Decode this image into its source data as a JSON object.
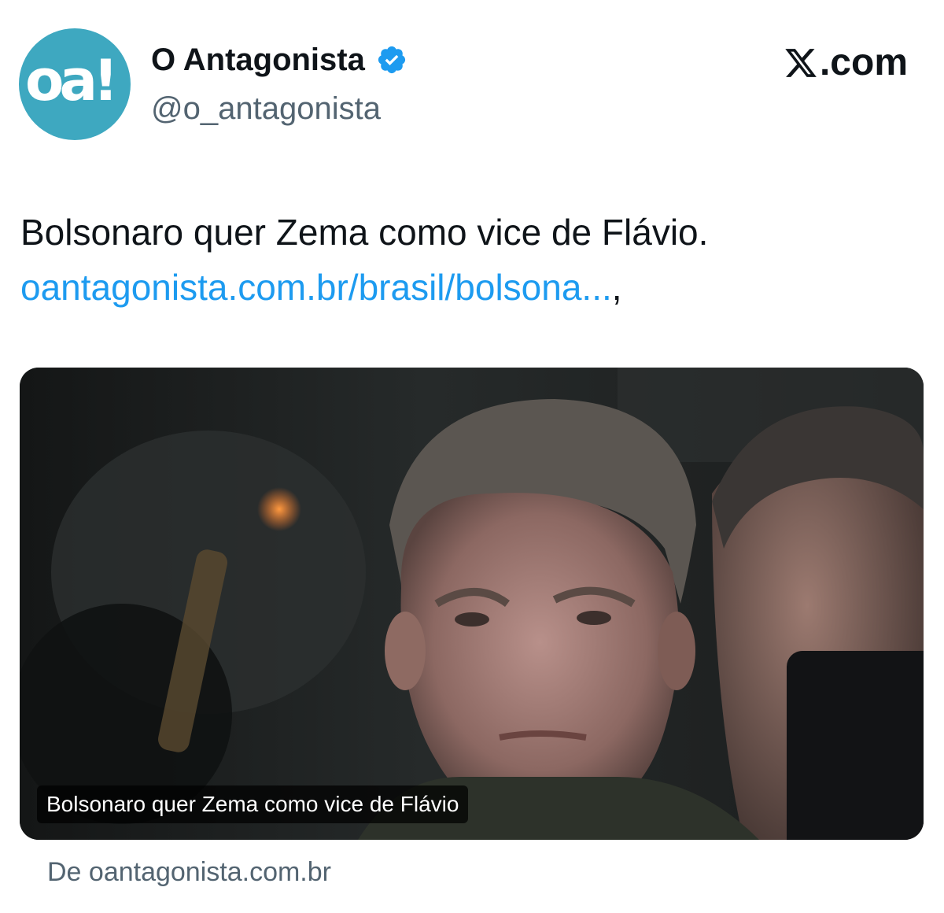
{
  "account": {
    "display_name": "O Antagonista",
    "handle": "@o_antagonista",
    "avatar_text": "oa!",
    "avatar_color": "#3ea8c0",
    "verified": true
  },
  "platform": {
    "logo_text": ".com"
  },
  "tweet": {
    "text": "Bolsonaro quer Zema como vice de Flávio.",
    "link_text": "oantagonista.com.br/brasil/bolsona...",
    "link_suffix": ",",
    "link_color": "#1d9bf0"
  },
  "card": {
    "caption": "Bolsonaro quer Zema como vice de Flávio",
    "source": "De oantagonista.com.br"
  }
}
